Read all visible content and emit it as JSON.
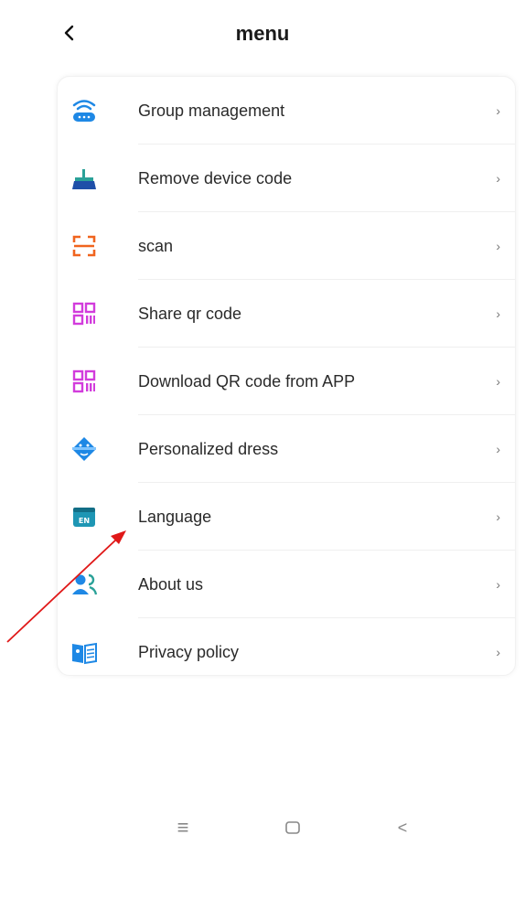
{
  "header": {
    "title": "menu"
  },
  "menu": {
    "items": [
      {
        "label": "Group management",
        "icon": "router-wifi-icon",
        "chevron": "›"
      },
      {
        "label": "Remove device code",
        "icon": "broom-icon",
        "chevron": "›"
      },
      {
        "label": "scan",
        "icon": "scan-icon",
        "chevron": "›"
      },
      {
        "label": "Share qr code",
        "icon": "qr-code-icon",
        "chevron": "›"
      },
      {
        "label": "Download QR code from APP",
        "icon": "qr-code-icon",
        "chevron": "›"
      },
      {
        "label": "Personalized dress",
        "icon": "dress-face-icon",
        "chevron": "›"
      },
      {
        "label": "Language",
        "icon": "language-en-icon",
        "icon_text": "EN",
        "chevron": "›"
      },
      {
        "label": "About us",
        "icon": "about-users-icon",
        "chevron": "›"
      },
      {
        "label": "Privacy policy",
        "icon": "book-icon",
        "chevron": "›"
      }
    ]
  },
  "nav": {
    "menu_glyph": "≡",
    "home_icon": "square-icon",
    "back_glyph": "<"
  },
  "colors": {
    "blue": "#1e88e5",
    "orange": "#f0641e",
    "magenta": "#d23cdc",
    "teal": "#1e96b4",
    "annotation": "#e01818"
  }
}
